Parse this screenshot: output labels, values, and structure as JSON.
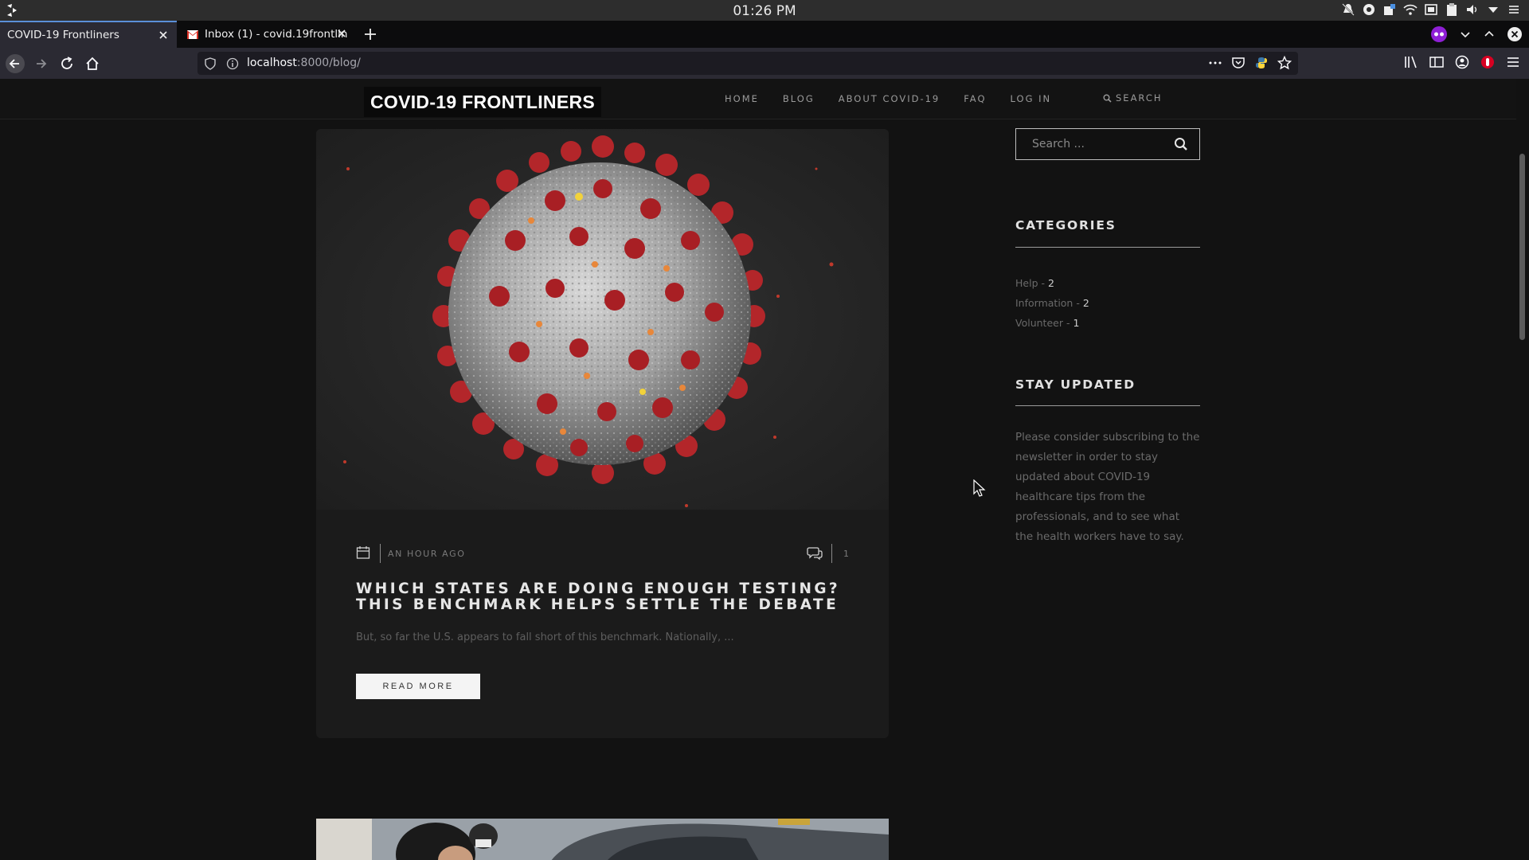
{
  "os": {
    "clock": "01:26 PM"
  },
  "browser": {
    "tabs": [
      {
        "title": "COVID-19 Frontliners"
      },
      {
        "title": "Inbox (1) - covid.19frontlin"
      }
    ],
    "url_host": "localhost",
    "url_rest": ":8000/blog/"
  },
  "site": {
    "logo": "COVID-19 FRONTLINERS",
    "menu": [
      "HOME",
      "BLOG",
      "ABOUT COVID-19",
      "FAQ",
      "LOG IN"
    ],
    "search_label": "SEARCH"
  },
  "post": {
    "date": "AN HOUR AGO",
    "comment_count": "1",
    "title_line1": "WHICH STATES ARE DOING ENOUGH TESTING?",
    "title_line2": "THIS BENCHMARK HELPS SETTLE THE DEBATE",
    "excerpt": "But, so far the U.S. appears to fall short of this benchmark. Nationally, ...",
    "read_more": "READ MORE"
  },
  "sidebar": {
    "search_placeholder": "Search ...",
    "categories_title": "CATEGORIES",
    "categories": [
      {
        "name": "Help",
        "count": "2"
      },
      {
        "name": "Information",
        "count": "2"
      },
      {
        "name": "Volunteer",
        "count": "1"
      }
    ],
    "stay_title": "STAY UPDATED",
    "stay_text": "Please consider subscribing to the newsletter in order to stay updated about COVID-19 healthcare tips from the professionals, and to see what the health workers have to say."
  },
  "icons": {
    "launcher": "launcher-icon",
    "back": "back-arrow-icon",
    "forward": "forward-arrow-icon",
    "reload": "reload-icon",
    "home": "home-icon"
  },
  "colors": {
    "background": "#121212",
    "card": "#1b1b1b",
    "virus_red": "#b3262a",
    "tab_accent": "#5a8fd8"
  }
}
